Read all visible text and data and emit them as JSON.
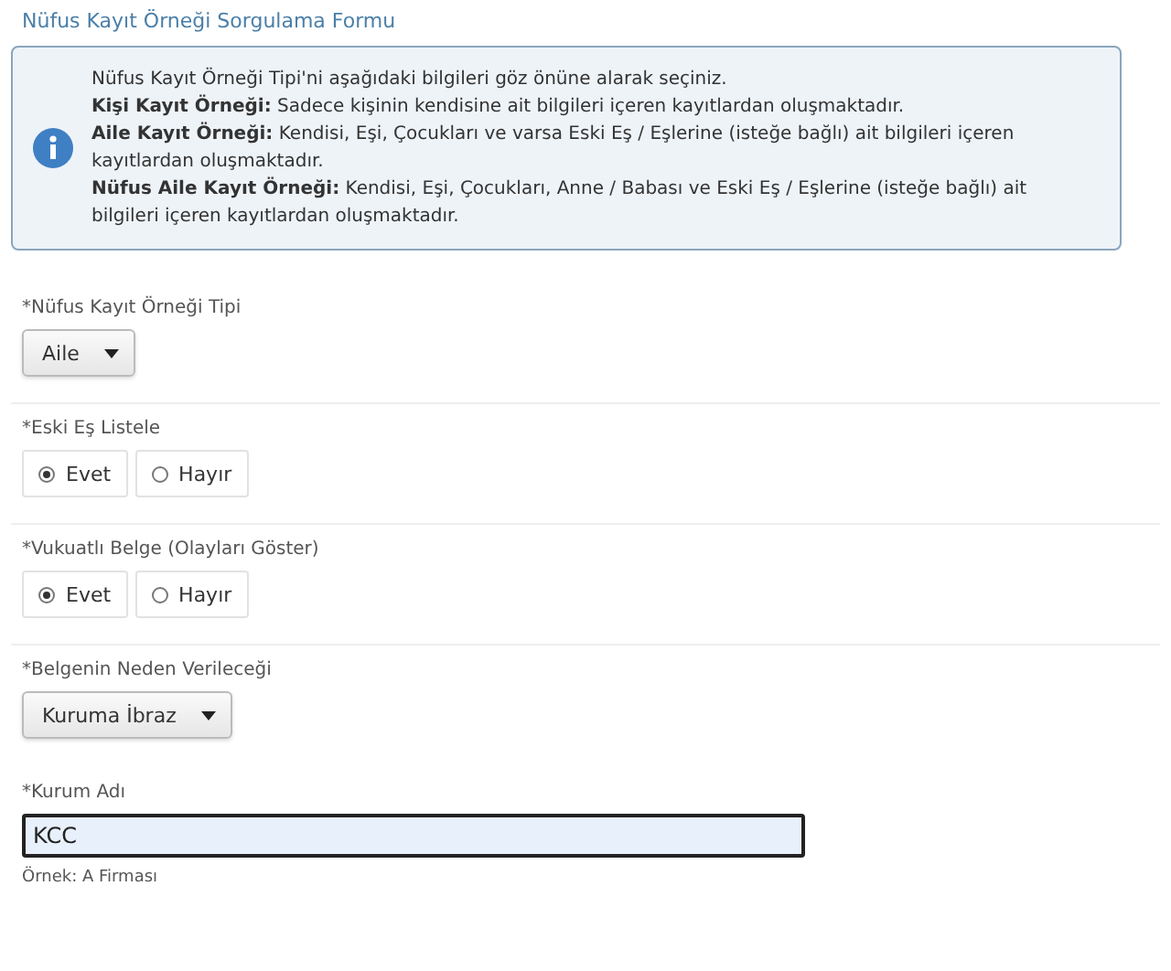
{
  "title": "Nüfus Kayıt Örneği Sorgulama Formu",
  "info": {
    "lines": [
      "Nüfus Kayıt Örneği Tipi'ni aşağıdaki bilgileri göz önüne alarak seçiniz.",
      "**Kişi Kayıt Örneği:** Sadece kişinin kendisine ait bilgileri içeren kayıtlardan oluşmaktadır.",
      "**Aile Kayıt Örneği:** Kendisi, Eşi, Çocukları ve varsa Eski Eş / Eşlerine (isteğe bağlı) ait bilgileri içeren kayıtlardan oluşmaktadır.",
      "**Nüfus Aile Kayıt Örneği:** Kendisi, Eşi, Çocukları, Anne / Babası ve Eski Eş / Eşlerine (isteğe bağlı) ait bilgileri içeren kayıtlardan oluşmaktadır."
    ]
  },
  "fields": [
    {
      "kind": "select",
      "label": "*Nüfus Kayıt Örneği Tipi",
      "value": "Aile",
      "divider": true
    },
    {
      "kind": "radio",
      "label": "*Eski Eş Listele",
      "options": [
        {
          "label": "Evet",
          "selected": true
        },
        {
          "label": "Hayır",
          "selected": false
        }
      ],
      "divider": true
    },
    {
      "kind": "radio",
      "label": "*Vukuatlı Belge (Olayları Göster)",
      "options": [
        {
          "label": "Evet",
          "selected": true
        },
        {
          "label": "Hayır",
          "selected": false
        }
      ],
      "divider": true
    },
    {
      "kind": "select",
      "label": "*Belgenin Neden Verileceği",
      "value": "Kuruma İbraz",
      "divider": false
    },
    {
      "kind": "text",
      "label": "*Kurum Adı",
      "value": "KCC",
      "hint": "Örnek: A Firması",
      "focused": true
    }
  ]
}
